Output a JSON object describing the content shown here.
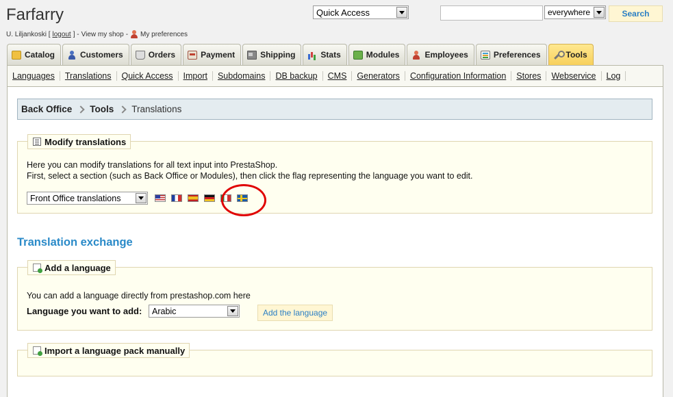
{
  "header": {
    "shop_name": "Farfarry",
    "user": "U. Liljankoski [",
    "logout": "logout",
    "user_sep": "] - ",
    "view_shop": "View my shop",
    "view_shop_sep": " - ",
    "preferences_link": "My preferences",
    "quick_access": "Quick Access",
    "search_placeholder": "",
    "search_scope": "everywhere",
    "search_button": "Search"
  },
  "tabs": [
    {
      "label": "Catalog",
      "icon": "folder-icon"
    },
    {
      "label": "Customers",
      "icon": "customers-icon"
    },
    {
      "label": "Orders",
      "icon": "cart-icon"
    },
    {
      "label": "Payment",
      "icon": "payment-icon"
    },
    {
      "label": "Shipping",
      "icon": "truck-icon"
    },
    {
      "label": "Stats",
      "icon": "stats-icon"
    },
    {
      "label": "Modules",
      "icon": "puzzle-icon"
    },
    {
      "label": "Employees",
      "icon": "employees-icon"
    },
    {
      "label": "Preferences",
      "icon": "preferences-icon"
    },
    {
      "label": "Tools",
      "icon": "wrench-icon",
      "active": true
    }
  ],
  "subnav": [
    "Languages",
    "Translations",
    "Quick Access",
    "Import",
    "Subdomains",
    "DB backup",
    "CMS",
    "Generators",
    "Configuration Information",
    "Stores",
    "Webservice",
    "Log"
  ],
  "breadcrumb": {
    "root": "Back Office",
    "section": "Tools",
    "current": "Translations"
  },
  "modify": {
    "title": "Modify translations",
    "line1": "Here you can modify translations for all text input into PrestaShop.",
    "line2": "First, select a section (such as Back Office or Modules), then click the flag representing the language you want to edit.",
    "section_value": "Front Office translations",
    "flags": [
      "us-flag",
      "fr-flag",
      "es-flag",
      "de-flag",
      "it-flag",
      "se-flag"
    ]
  },
  "exchange_title": "Translation exchange",
  "add_language": {
    "title": "Add a language",
    "text": "You can add a language directly from prestashop.com here",
    "label": "Language you want to add:",
    "selected": "Arabic",
    "button": "Add the language"
  },
  "import_pack": {
    "title": "Import a language pack manually"
  },
  "colors": {
    "accent": "#2a8ac8",
    "active_tab": "#f7d05c",
    "highlight_circle": "#e00000"
  }
}
